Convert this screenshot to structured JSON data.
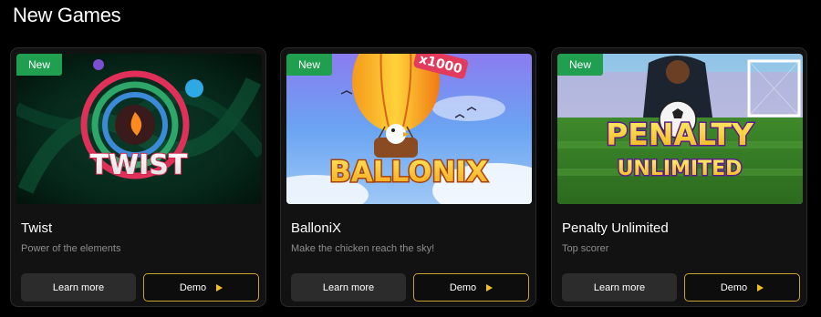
{
  "section": {
    "title": "New Games"
  },
  "games": [
    {
      "badge": "New",
      "art_text": "TWIST",
      "title": "Twist",
      "subtitle": "Power of the elements",
      "learn_label": "Learn more",
      "demo_label": "Demo"
    },
    {
      "badge": "New",
      "art_text": "BALLONIX",
      "art_multiplier": "x1000",
      "title": "BalloniX",
      "subtitle": "Make the chicken reach the sky!",
      "learn_label": "Learn more",
      "demo_label": "Demo"
    },
    {
      "badge": "New",
      "art_text_line1": "PENALTY",
      "art_text_line2": "UNLIMITED",
      "title": "Penalty Unlimited",
      "subtitle": "Top scorer",
      "learn_label": "Learn more",
      "demo_label": "Demo"
    }
  ],
  "colors": {
    "badge": "#1f9f4f",
    "demo_border": "#c8a530",
    "play_icon": "#f2c01f"
  },
  "icons": {
    "demo": "play-triangle-icon"
  }
}
